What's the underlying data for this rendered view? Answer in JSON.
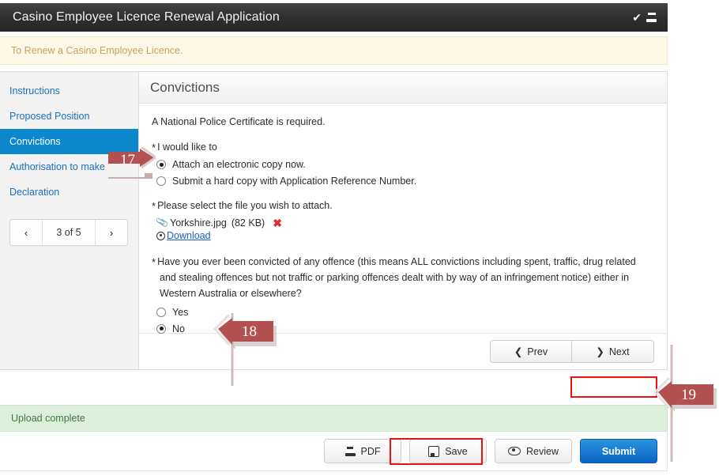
{
  "titlebar": {
    "title": "Casino Employee Licence Renewal Application",
    "check_icon": "check-icon",
    "print_icon": "printer-icon"
  },
  "info_strip": {
    "text": "To Renew a Casino Employee Licence."
  },
  "sidebar": {
    "items": [
      {
        "label": "Instructions",
        "active": false
      },
      {
        "label": "Proposed Position",
        "active": false
      },
      {
        "label": "Convictions",
        "active": true
      },
      {
        "label": "Authorisation to make",
        "active": false
      },
      {
        "label": "Declaration",
        "active": false
      }
    ],
    "pager": {
      "prev_glyph": "‹",
      "label": "3 of 5",
      "next_glyph": "›"
    }
  },
  "content": {
    "title": "Convictions",
    "lead": "A National Police Certificate is required.",
    "section_attach": {
      "required_marker": "*",
      "label": "I would like to",
      "options": [
        {
          "label": "Attach an electronic copy now.",
          "selected": true
        },
        {
          "label": "Submit a hard copy with Application Reference Number.",
          "selected": false
        }
      ]
    },
    "section_file": {
      "required_marker": "*",
      "label": "Please select the file you wish to attach.",
      "attachment": {
        "clip_icon": "paperclip-icon",
        "filename": "Yorkshire.jpg",
        "filesize": "(82 KB)",
        "delete_glyph": "✖"
      },
      "download": {
        "icon": "download-circle-icon",
        "label": "Download"
      }
    },
    "section_convicted": {
      "required_marker": "*",
      "question": "Have you ever been convicted of any offence (this means ALL convictions including spent, traffic, drug related and stealing offences but not traffic or parking offences dealt with by way of an infringement notice) either in Western Australia or elsewhere?",
      "options": [
        {
          "label": "Yes",
          "selected": false
        },
        {
          "label": "No",
          "selected": true
        }
      ]
    },
    "footer": {
      "prev_glyph": "❮",
      "prev_label": "Prev",
      "next_glyph": "❯",
      "next_label": "Next"
    }
  },
  "status_bar": {
    "text": "Upload complete"
  },
  "action_bar": {
    "buttons": [
      {
        "label": "PDF",
        "icon": "printer-icon",
        "style": "default"
      },
      {
        "label": "Save",
        "icon": "save-icon",
        "style": "default"
      },
      {
        "label": "Review",
        "icon": "eye-icon",
        "style": "default"
      },
      {
        "label": "Submit",
        "icon": "",
        "style": "primary"
      }
    ]
  },
  "annotations": {
    "callouts": [
      {
        "number": "17",
        "direction": "right"
      },
      {
        "number": "18",
        "direction": "left"
      },
      {
        "number": "19",
        "direction": "left"
      }
    ],
    "highlight_color": "#ee1111",
    "callout_color": "#b35050"
  }
}
